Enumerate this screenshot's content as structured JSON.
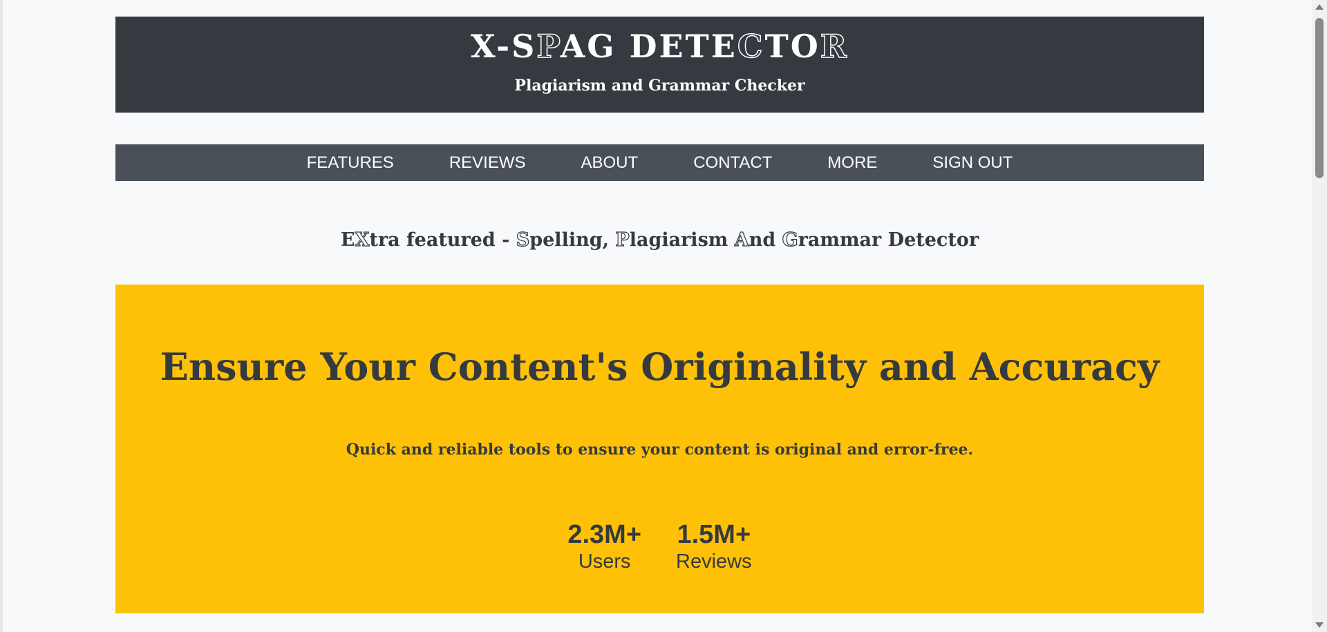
{
  "header": {
    "title_parts": [
      "X-S",
      "P",
      "AG DETE",
      "C",
      "TO",
      "R"
    ],
    "subtitle": "Plagiarism and Grammar Checker"
  },
  "nav": {
    "items": [
      {
        "label": "FEATURES"
      },
      {
        "label": "REVIEWS"
      },
      {
        "label": "ABOUT"
      },
      {
        "label": "CONTACT"
      },
      {
        "label": "MORE"
      },
      {
        "label": "SIGN OUT"
      }
    ]
  },
  "tagline": {
    "parts": [
      "E",
      "X",
      "tra featured - ",
      "S",
      "pelling, ",
      "P",
      "lagiarism ",
      "A",
      "nd ",
      "G",
      "rammar Detector"
    ]
  },
  "hero": {
    "title": "Ensure Your Content's Originality and Accuracy",
    "subtitle": "Quick and reliable tools to ensure your content is original and error-free.",
    "stats": [
      {
        "value": "2.3M+",
        "label": "Users"
      },
      {
        "value": "1.5M+",
        "label": "Reviews"
      }
    ]
  },
  "colors": {
    "header_bg": "#343a40",
    "nav_bg": "#495057",
    "hero_bg": "#ffc107",
    "page_bg": "#f8f9fa",
    "text_dark": "#343a40"
  }
}
